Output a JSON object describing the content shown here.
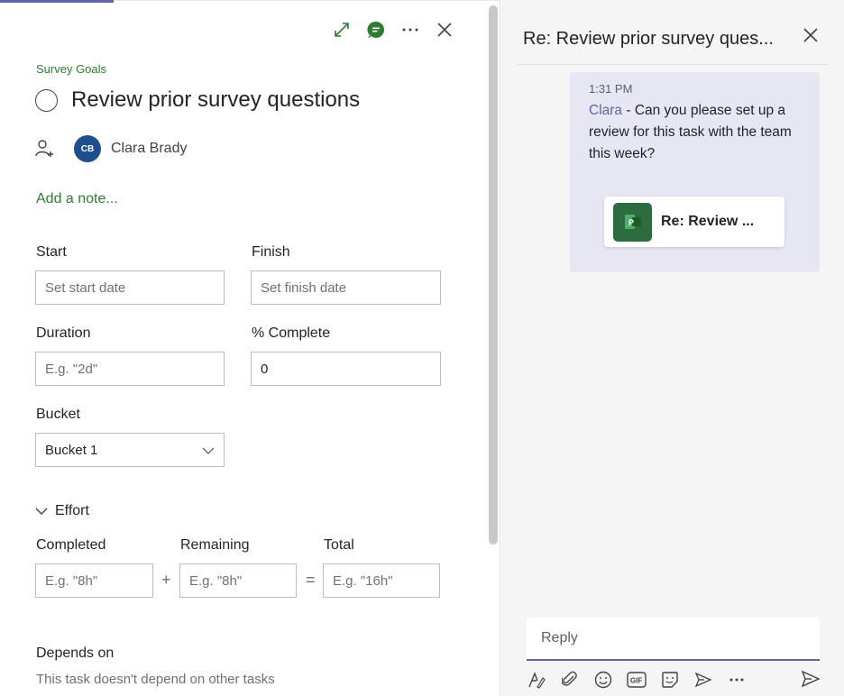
{
  "task_panel": {
    "plan_name": "Survey Goals",
    "task_title": "Review prior survey questions",
    "assignee": {
      "initials": "CB",
      "name": "Clara Brady"
    },
    "add_note": "Add a note...",
    "start": {
      "label": "Start",
      "placeholder": "Set start date"
    },
    "finish": {
      "label": "Finish",
      "placeholder": "Set finish date"
    },
    "duration": {
      "label": "Duration",
      "placeholder": "E.g. \"2d\""
    },
    "percent_complete": {
      "label": "% Complete",
      "value": "0"
    },
    "bucket": {
      "label": "Bucket",
      "value": "Bucket 1"
    },
    "effort": {
      "label": "Effort",
      "completed": {
        "label": "Completed",
        "placeholder": "E.g. \"8h\""
      },
      "remaining": {
        "label": "Remaining",
        "placeholder": "E.g. \"8h\""
      },
      "total": {
        "label": "Total",
        "placeholder": "E.g. \"16h\""
      },
      "plus": "+",
      "equals": "="
    },
    "depends_on": {
      "label": "Depends on",
      "text": "This task doesn't depend on other tasks"
    },
    "header_icons": [
      "expand-icon",
      "chat-icon",
      "more-icon",
      "close-icon"
    ]
  },
  "conversation": {
    "title": "Re: Review prior survey ques...",
    "message": {
      "time": "1:31 PM",
      "author": "Clara",
      "text": " - Can you please set up a review for this task with the team this week?"
    },
    "card": {
      "label": "Re: Review ..."
    },
    "reply_placeholder": "Reply",
    "toolbar_icons": [
      "format-icon",
      "attach-icon",
      "emoji-icon",
      "gif-icon",
      "sticker-icon",
      "meet-icon",
      "more-options-icon",
      "send-icon"
    ]
  },
  "colors": {
    "accent": "#6264a7",
    "plan_green": "#2e7d32",
    "avatar_blue": "#1f4e8c"
  }
}
